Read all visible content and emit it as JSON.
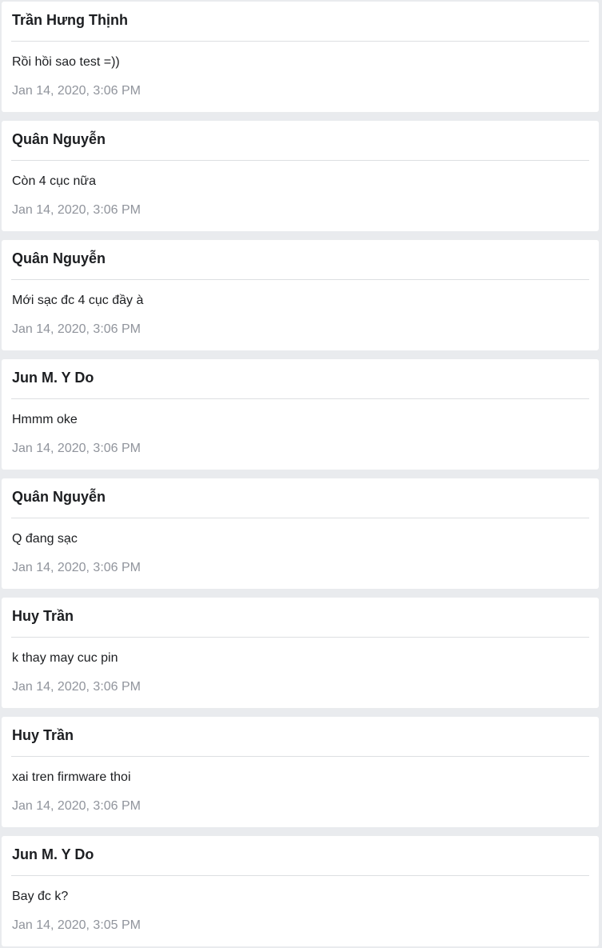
{
  "messages": [
    {
      "author": "Trần Hưng Thịnh",
      "text": "Rồi hồi sao test =))",
      "time": "Jan 14, 2020, 3:06 PM"
    },
    {
      "author": "Quân Nguyễn",
      "text": "Còn 4 cục nữa",
      "time": "Jan 14, 2020, 3:06 PM"
    },
    {
      "author": "Quân Nguyễn",
      "text": "Mới sạc đc 4 cục đầy à",
      "time": "Jan 14, 2020, 3:06 PM"
    },
    {
      "author": "Jun M. Y Do",
      "text": "Hmmm oke",
      "time": "Jan 14, 2020, 3:06 PM"
    },
    {
      "author": "Quân Nguyễn",
      "text": "Q đang sạc",
      "time": "Jan 14, 2020, 3:06 PM"
    },
    {
      "author": "Huy Trần",
      "text": "k thay may cuc pin",
      "time": "Jan 14, 2020, 3:06 PM"
    },
    {
      "author": "Huy Trần",
      "text": "xai tren firmware thoi",
      "time": "Jan 14, 2020, 3:06 PM"
    },
    {
      "author": "Jun M. Y Do",
      "text": "Bay đc k?",
      "time": "Jan 14, 2020, 3:05 PM"
    }
  ]
}
